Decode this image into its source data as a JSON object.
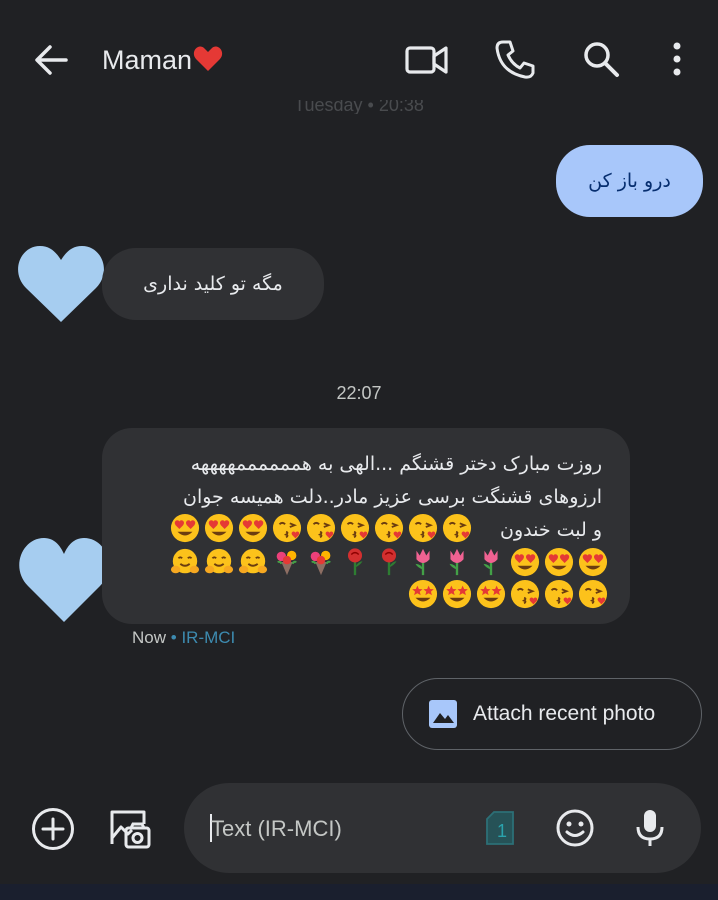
{
  "header": {
    "title": "Maman",
    "title_emoji": "heart-emoji",
    "ghost_date": "Tuesday • 20:38",
    "icons": [
      "back-arrow-icon",
      "video-call-icon",
      "phone-icon",
      "search-icon",
      "more-vert-icon"
    ]
  },
  "messages": {
    "outgoing_1": "درو باز کن",
    "incoming_1": "مگه تو کلید نداری",
    "time_separator": "22:07",
    "incoming_2_text": "روزت مبارک دختر قشنگم ...الهی به هممممممههههه\nارزوهای قشنگت برسی عزیز مادر..دلت همیسه جوان\nو لبت خندون",
    "incoming_2_emoji_lines": [
      [
        "kiss",
        "kiss",
        "kiss",
        "kiss",
        "kiss",
        "kiss",
        "heart-eyes",
        "heart-eyes",
        "heart-eyes"
      ],
      [
        "heart-eyes",
        "heart-eyes",
        "heart-eyes",
        "tulip",
        "tulip",
        "tulip",
        "rose",
        "rose",
        "bouquet",
        "bouquet",
        "hug",
        "hug",
        "hug"
      ],
      [
        "kiss",
        "kiss",
        "kiss",
        "star-struck",
        "star-struck",
        "star-struck"
      ]
    ],
    "status": "Now",
    "status_dot": "•",
    "carrier": "IR-MCI"
  },
  "suggestion": {
    "label": "Attach recent photo",
    "icon": "image-icon"
  },
  "composer": {
    "placeholder": "Text (IR-MCI)",
    "sim_label": "1",
    "icons": [
      "add-icon",
      "gallery-icon",
      "sim-icon",
      "emoji-icon",
      "mic-icon"
    ]
  },
  "colors": {
    "background": "#202124",
    "incoming_bubble": "#303134",
    "outgoing_bubble": "#a8c7fa",
    "outgoing_text": "#062e6f",
    "carrier": "#3d8bb0",
    "avatar": "#a6cdf0"
  }
}
